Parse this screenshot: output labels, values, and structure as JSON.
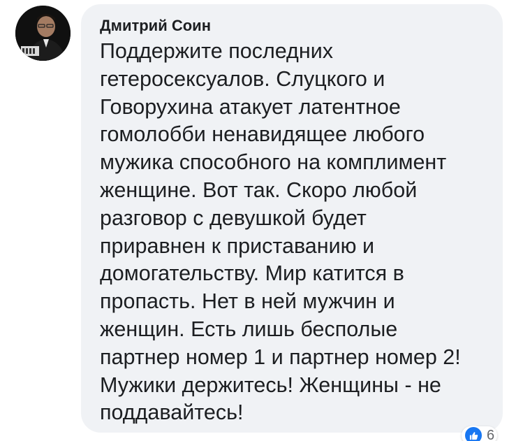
{
  "comment": {
    "author": "Дмитрий Соин",
    "text_lines": [
      "Поддержите последних",
      "гетеросексуалов. Слуцкого и",
      "Говорухина атакует латентное",
      "гомолобби ненавидящее любого",
      "мужика способного на комплимент",
      "женщине. Вот так. Скоро любой",
      "разговор с девушкой будет",
      "приравнен к приставанию и",
      "домогательству. Мир катится в",
      "пропасть. Нет в ней мужчин и",
      "женщин. Есть лишь бесполые",
      "партнер номер 1 и партнер номер 2!",
      "Мужики держитесь! Женщины - не",
      "поддавайтесь!"
    ],
    "reactions": {
      "icon": "like-icon",
      "count": "6",
      "color": "#1877f2"
    }
  },
  "colors": {
    "bubble_bg": "#f0f2f5",
    "text": "#1c1e21"
  }
}
